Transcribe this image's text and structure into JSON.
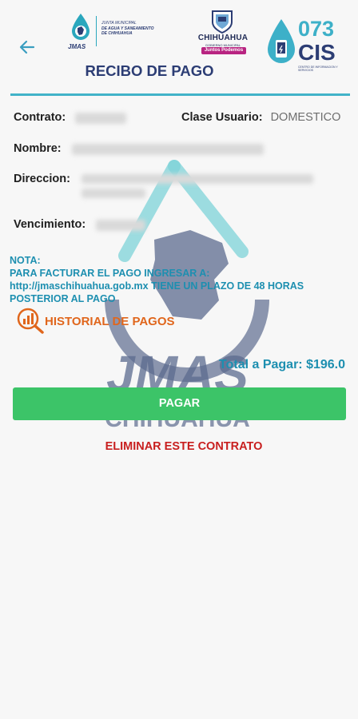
{
  "header": {
    "title": "RECIBO DE PAGO",
    "imas_logo": {
      "word": "JMAS",
      "line1": "JUNTA MUNICIPAL",
      "line2": "DE AGUA Y SANEAMIENTO",
      "line3": "DE CHIHUAHUA"
    },
    "chihuahua_logo": {
      "word": "CHIHUAHUA",
      "sub": "GOBIERNO MUNICIPAL",
      "tag": "Juntos Podemos"
    },
    "cis_logo": {
      "number": "073",
      "word": "CIS",
      "sub": "CENTRO DE INFORMACION Y SERVICIOS"
    }
  },
  "receipt": {
    "contrato_label": "Contrato:",
    "clase_label": "Clase Usuario:",
    "clase_value": "DOMESTICO",
    "nombre_label": "Nombre:",
    "direccion_label": "Direccion:",
    "vencimiento_label": "Vencimiento:"
  },
  "nota": {
    "title": "NOTA:",
    "text": "PARA FACTURAR EL PAGO INGRESAR A: http://jmaschihuahua.gob.mx TIENE UN PLAZO DE 48 HORAS POSTERIOR AL PAGO"
  },
  "historial": {
    "label": "HISTORIAL DE PAGOS"
  },
  "total": {
    "label": "Total a Pagar: $196.0"
  },
  "actions": {
    "pay": "PAGAR",
    "delete": "ELIMINAR ESTE CONTRATO"
  },
  "watermark": {
    "line1": "JMAS",
    "line2": "CHIHUAHUA"
  },
  "colors": {
    "navy": "#2c3d74",
    "teal": "#41b3c8",
    "link_blue": "#1d8fb0",
    "orange": "#e0661c",
    "green": "#3cc468",
    "red": "#c81f1f"
  }
}
